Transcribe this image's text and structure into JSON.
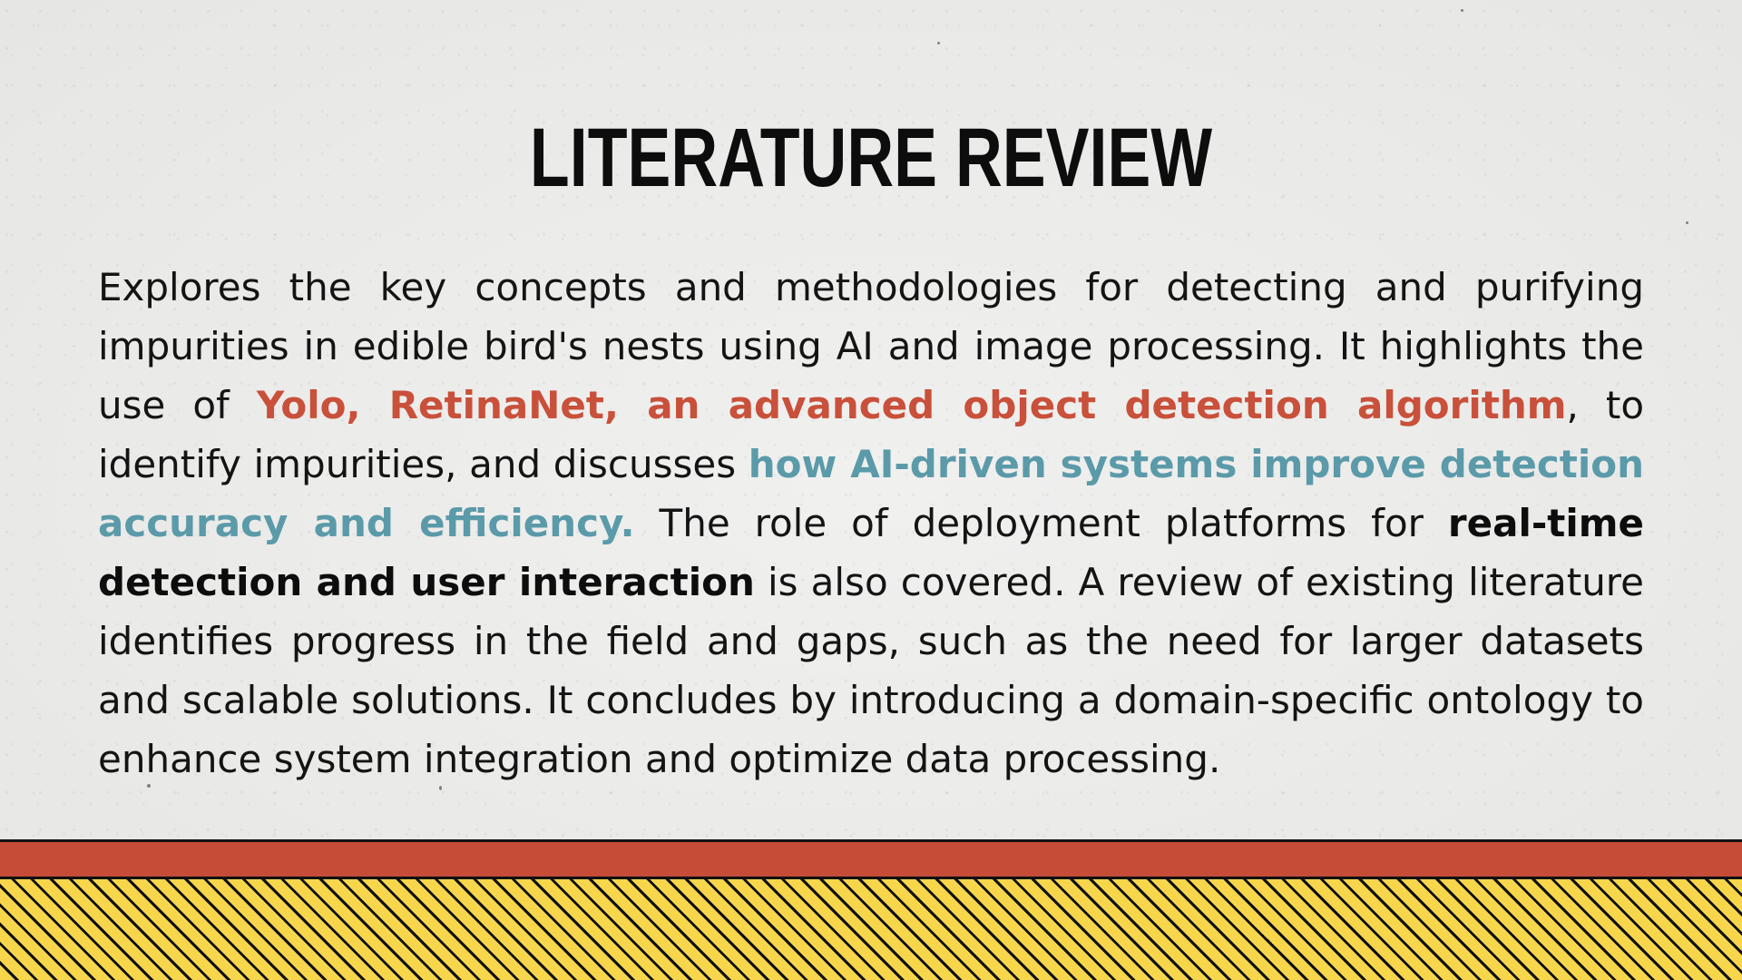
{
  "slide": {
    "title": "LITERATURE REVIEW",
    "paragraph": {
      "segment_1": "Explores the key concepts and methodologies for detecting and purifying impurities in edible bird's nests using AI and image processing. It highlights the use of ",
      "highlight_red": "Yolo, RetinaNet, an advanced object detection algorithm",
      "segment_2": ", to identify impurities, and discusses ",
      "highlight_blue": "how AI-driven systems improve detection accuracy and efficiency.",
      "segment_3": " The role of deployment platforms for ",
      "highlight_bold": "real-time detection and user interaction",
      "segment_4": " is also covered. A review of existing literature identifies progress in the field and gaps, such as the need for larger datasets and scalable solutions. It concludes by introducing a domain-specific ontology to enhance system integration and optimize data processing."
    }
  },
  "colors": {
    "background": "#ebebea",
    "title": "#0d0d0d",
    "text": "#141414",
    "accent_red": "#c9503a",
    "accent_blue": "#5b9aa9",
    "footer_red": "#c64c38",
    "footer_yellow": "#f7d64c",
    "footer_stripe": "#111111"
  }
}
